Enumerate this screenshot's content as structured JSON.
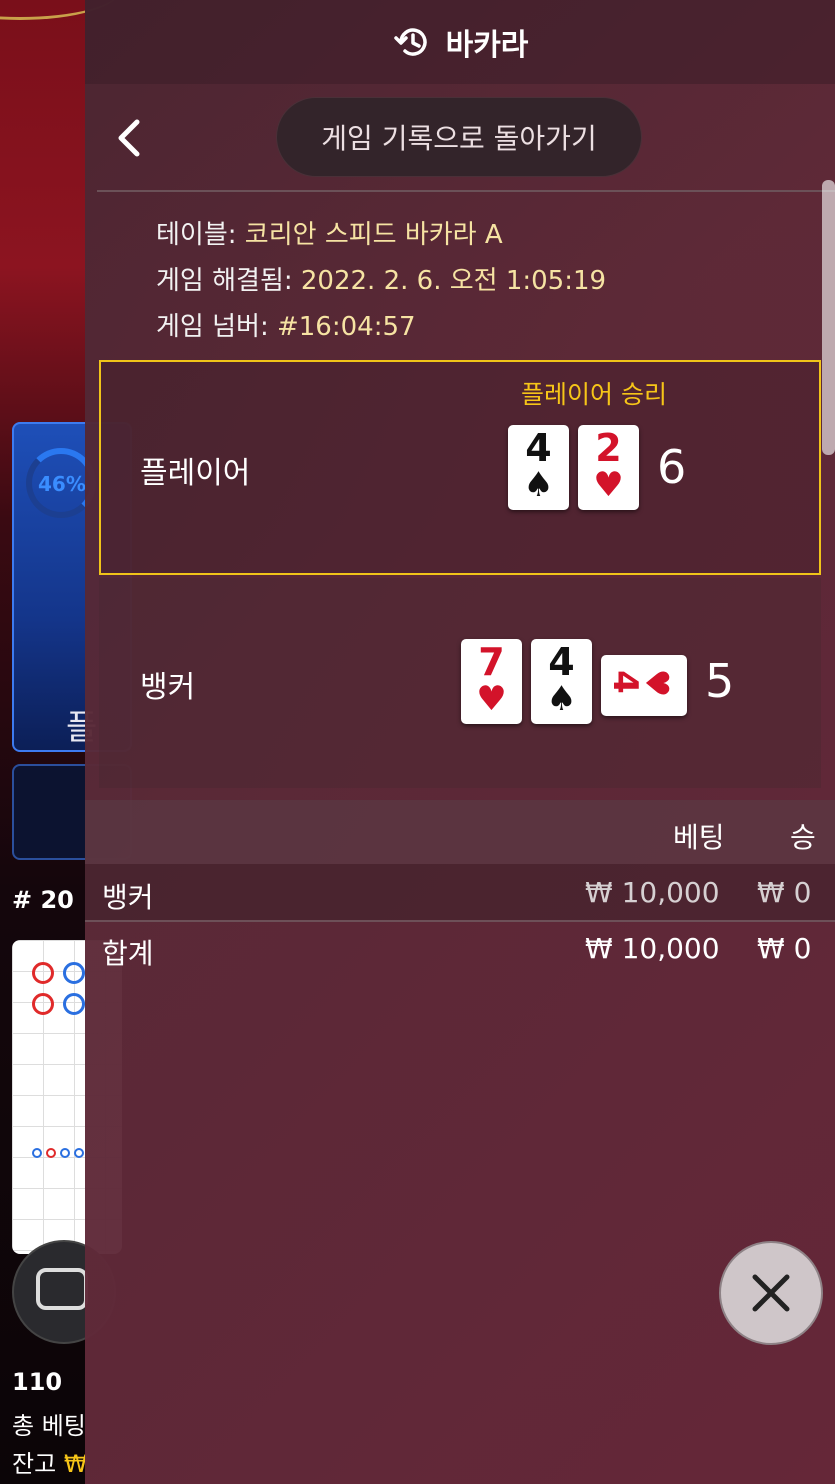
{
  "background": {
    "player_percent": "46%",
    "player_label": "플",
    "round_label": "# 20",
    "player_count": "110",
    "total_bet_label": "총 베팅",
    "balance_label": "잔고",
    "currency": "₩"
  },
  "header": {
    "title": "바카라",
    "icon": "history-icon"
  },
  "nav": {
    "back_icon": "chevron-left-icon",
    "return_label": "게임 기록으로 돌아가기"
  },
  "info": {
    "table_key": "테이블:",
    "table_value": "코리안 스피드 바카라 A",
    "resolved_key": "게임 해결됨:",
    "resolved_value": "2022. 2. 6. 오전 1:05:19",
    "number_key": "게임 넘버:",
    "number_value": "#16:04:57"
  },
  "result": {
    "win_label": "플레이어 승리",
    "player": {
      "label": "플레이어",
      "score": "6",
      "cards": [
        {
          "rank": "4",
          "suit": "♠",
          "color": "black"
        },
        {
          "rank": "2",
          "suit": "♥",
          "color": "red"
        }
      ]
    },
    "banker": {
      "label": "뱅커",
      "score": "5",
      "cards": [
        {
          "rank": "7",
          "suit": "♥",
          "color": "red"
        },
        {
          "rank": "4",
          "suit": "♠",
          "color": "black"
        },
        {
          "rank": "4",
          "suit": "♥",
          "color": "red",
          "sideways": true
        }
      ]
    }
  },
  "bets_table": {
    "headers": [
      "베팅",
      "승"
    ],
    "rows": [
      {
        "label": "뱅커",
        "bet": "₩ 10,000",
        "win": "₩ 0"
      }
    ],
    "total": {
      "label": "합계",
      "bet": "₩ 10,000",
      "win": "₩ 0"
    }
  },
  "close_icon": "close-icon",
  "colors": {
    "accent_gold": "#f6c518",
    "info_value": "#f6e3a3",
    "red_suit": "#d3132a",
    "player_blue": "#1e4fb8"
  }
}
